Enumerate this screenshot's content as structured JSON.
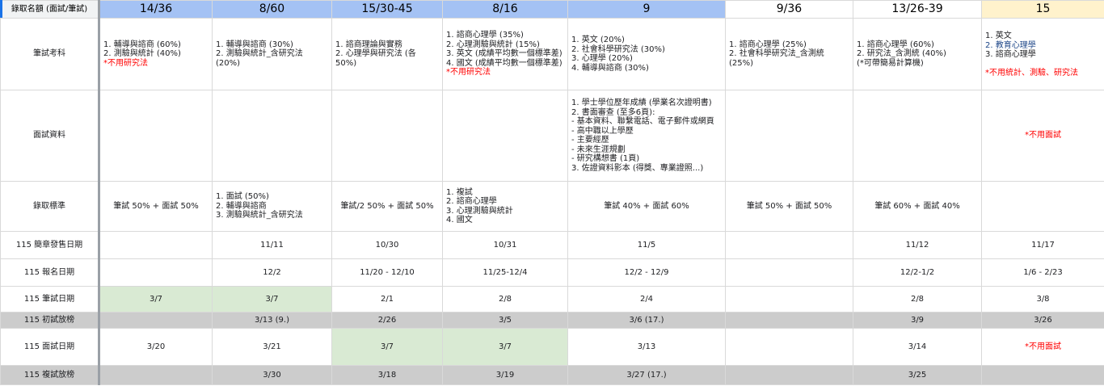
{
  "colors": {
    "header_blue": "#a4c2f4",
    "header_yellow": "#fff2cc",
    "green_fill": "#d9ead3",
    "gray_row": "#cccccc",
    "red_text": "#ff0000",
    "blue_text": "#1c4587"
  },
  "row_labels": {
    "quota": "錄取名額 (面試/筆試)",
    "written": "筆試考科",
    "interview": "面試資料",
    "criteria": "錄取標準",
    "brochure": "115 簡章發售日期",
    "register": "115 報名日期",
    "written_date": "115 筆試日期",
    "first_list": "115 初試放榜",
    "interview_date": "115 面試日期",
    "final_list": "115 複試放榜"
  },
  "quota": [
    "14/36",
    "8/60",
    "15/30-45",
    "8/16",
    "9",
    "9/36",
    "13/26-39",
    "15"
  ],
  "written": {
    "c1": "1. 輔導與諮商 (60%)\n2. 測驗與統計 (40%)",
    "c1_note": "*不用研究法",
    "c2": "1. 輔導與諮商 (30%)\n2. 測驗與統計_含研究法 (20%)",
    "c3": "1. 諮商理論與實務\n2. 心理學與研究法 (各 50%)",
    "c4": "1. 諮商心理學 (35%)\n2. 心理測驗與統計 (15%)\n3. 英文 (成績平均數一個標準差)\n4. 國文 (成績平均數一個標準差)",
    "c4_note": "*不用研究法",
    "c5": "1. 英文 (20%)\n2. 社會科學研究法 (30%)\n3. 心理學 (20%)\n4. 輔導與諮商 (30%)",
    "c6": "1. 諮商心理學 (25%)\n2. 社會科學研究法_含測統 (25%)",
    "c7": "1. 諮商心理學 (60%)\n2. 研究法_含測統 (40%)\n(*可帶簡易計算機)",
    "c8_line1": "1. 英文",
    "c8_line2": "2. 教育心理學",
    "c8_line3": "3. 諮商心理學",
    "c8_note": "*不用統計、測驗、研究法"
  },
  "interview": {
    "c5": "1. 學士學位歷年成績 (學業名次證明書)\n2. 書面審查 (至多6頁):\n- 基本資料、聯繫電話、電子郵件或網頁\n- 高中職以上學歷\n- 主要經歷\n- 未來生涯規劃\n- 研究構想書 (1頁)\n3. 佐證資料影本 (得獎、專業證照...)",
    "c8_note": "*不用面試"
  },
  "criteria": {
    "c1": "筆試 50% + 面試 50%",
    "c2": "1. 面試 (50%)\n2. 輔導與諮商\n3. 測驗與統計_含研究法",
    "c3": "筆試/2 50% + 面試 50%",
    "c4": "1. 複試\n2. 諮商心理學\n3. 心理測驗與統計\n4. 國文",
    "c5": "筆試 40% + 面試 60%",
    "c6": "筆試 50% + 面試 50%",
    "c7": "筆試 60% + 面試 40%"
  },
  "brochure": [
    "",
    "11/11",
    "10/30",
    "10/31",
    "11/5",
    "",
    "11/12",
    "11/17"
  ],
  "register": [
    "",
    "12/2",
    "11/20 - 12/10",
    "11/25-12/4",
    "12/2 - 12/9",
    "",
    "12/2-1/2",
    "1/6 - 2/23"
  ],
  "written_date": [
    "3/7",
    "3/7",
    "2/1",
    "2/8",
    "2/4",
    "",
    "2/8",
    "3/8"
  ],
  "first_list": [
    "",
    "3/13 (9.)",
    "2/26",
    "3/5",
    "3/6 (17.)",
    "",
    "3/9",
    "3/26"
  ],
  "interview_date": [
    "3/20",
    "3/21",
    "3/7",
    "3/7",
    "3/13",
    "",
    "3/14",
    "*不用面試"
  ],
  "final_list": [
    "",
    "3/30",
    "3/18",
    "3/19",
    "3/27 (17.)",
    "",
    "3/25",
    ""
  ]
}
